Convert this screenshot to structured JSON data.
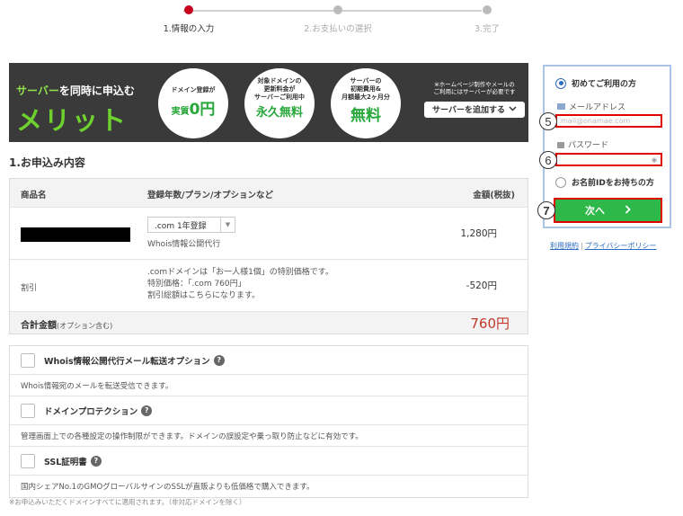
{
  "stepper": {
    "steps": [
      {
        "label": "1.情報の入力",
        "active": true
      },
      {
        "label": "2.お支払いの選択",
        "active": false
      },
      {
        "label": "3.完了",
        "active": false
      }
    ]
  },
  "banner": {
    "head_green": "サーバー",
    "head_white": "を同時に申込む",
    "big": "メリット",
    "circles": [
      {
        "top": "ドメイン登録が",
        "jitsu": "実質",
        "bottom": "0円"
      },
      {
        "top": "対象ドメインの\n更新料金が\nサーバーご利用中",
        "jitsu": "",
        "bottom": "永久無料"
      },
      {
        "top": "サーバーの\n初期費用&\n月額最大2ヶ月分",
        "jitsu": "",
        "bottom": "無料"
      }
    ],
    "note": "※ホームページ制作やメールの\nご利用にはサーバーが必要です",
    "add_button": "サーバーを追加する"
  },
  "order": {
    "section_title": "1.お申込み内容",
    "headers": {
      "product": "商品名",
      "plan": "登録年数/プラン/オプションなど",
      "amount": "金額(税抜)"
    },
    "item": {
      "select_value": ".com 1年登録",
      "sub": "Whois情報公開代行",
      "price": "1,280円"
    },
    "discount": {
      "label": "割引",
      "lines": [
        ".comドメインは「お一人様1個」の特別価格です。",
        "特別価格：「.com 760円」",
        "割引総額はこちらになります。"
      ],
      "price": "-520円"
    },
    "total": {
      "label": "合計金額",
      "label_note": "(オプション含む)",
      "price": "760円"
    }
  },
  "options": [
    {
      "title": "Whois情報公開代行メール転送オプション",
      "desc": "Whois情報宛のメールを転送受信できます。"
    },
    {
      "title": "ドメインプロテクション",
      "desc": "管理画面上での各種設定の操作制限ができます。ドメインの誤設定や乗っ取り防止などに有効です。"
    },
    {
      "title": "SSL証明書",
      "desc": "国内シェアNo.1のGMOグローバルサインのSSLが直販よりも低価格で購入できます。"
    }
  ],
  "footnote": "※お申込みいただくドメインすべてに適用されます。（非対応ドメインを除く）",
  "login": {
    "first_time": "初めてご利用の方",
    "email_label": "メールアドレス",
    "email_placeholder": "mail@onamae.com",
    "password_label": "パスワード",
    "has_id": "お名前IDをお持ちの方",
    "next_button": "次へ",
    "annotations": [
      "5",
      "6",
      "7"
    ]
  },
  "links": {
    "terms": "利用規約",
    "privacy": "プライバシーポリシー"
  },
  "colors": {
    "accent_red": "#c8001e",
    "cta_green": "#2fb84a",
    "annotation_red": "#e00000"
  }
}
